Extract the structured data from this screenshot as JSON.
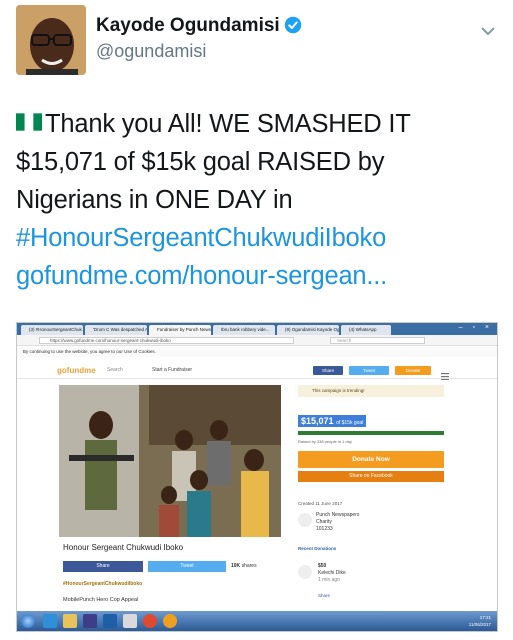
{
  "tweet": {
    "author_name": "Kayode Ogundamisi",
    "handle": "@ogundamisi",
    "lines": [
      "Thank you All! WE SMASHED IT",
      "$15,071 of $15k goal RAISED by",
      "Nigerians in ONE DAY in",
      "#HonourSergeantChukwudiIboko",
      "gofundme.com/honour-sergean..."
    ]
  },
  "browser": {
    "tabs": [
      "(3) #HonourSergeantChuk...",
      "'Drum C Was despatched A...",
      "Fundraiser by Punch News...",
      "Ibru bank robbery vide...",
      "(9) Ogundamisi Kayode Ogundi...",
      "(4) WhatsApp"
    ],
    "url": "https://www.gofundme.com/honour-sergeant-chukwudi-iboko",
    "search_placeholder": "Search",
    "cookie_notice": "By continuing to use the website, you agree to our Use of Cookies."
  },
  "gofundme": {
    "logo": "gofundme",
    "search_label": "Search",
    "start_label": "Start a Fundraiser",
    "share_label": "Share",
    "tweet_label": "Tweet",
    "donate_label": "Donate",
    "campaign_title": "Honour Sergeant Chukwudi Iboko",
    "fb_share_label": "Share",
    "tw_share_label": "Tweet",
    "shares_count": "10K",
    "shares_label": "shares",
    "hashtag": "#HonourSergeantChukwudiIboko",
    "appeal": "MobilePunch Hero Cop Appeal",
    "trending": "This campaign is trending!",
    "raised_amount": "$15,071",
    "raised_goal": "of $15k goal",
    "progress": 1.0,
    "raised_by": "Raised by 338 people in 1 day",
    "donate_now": "Donate Now",
    "share_on_facebook": "Share on Facebook",
    "created": "Created 11 June 2017",
    "organizer": "Punch Newspapers",
    "organizer_type": "Charity",
    "organizer_location": "101233",
    "recent_donations": "Recent Donations",
    "donation_amount": "$50",
    "donor": "Kelechi Dike",
    "donation_time": "1 min ago",
    "donation_share": "Share"
  },
  "taskbar": {
    "time": "17:21",
    "date": "11/06/2017"
  },
  "colors": {
    "link": "#1b95e0",
    "verified": "#1da1f2",
    "donate": "#f39c1f",
    "facebook": "#3b5998",
    "twitter": "#55acee"
  }
}
